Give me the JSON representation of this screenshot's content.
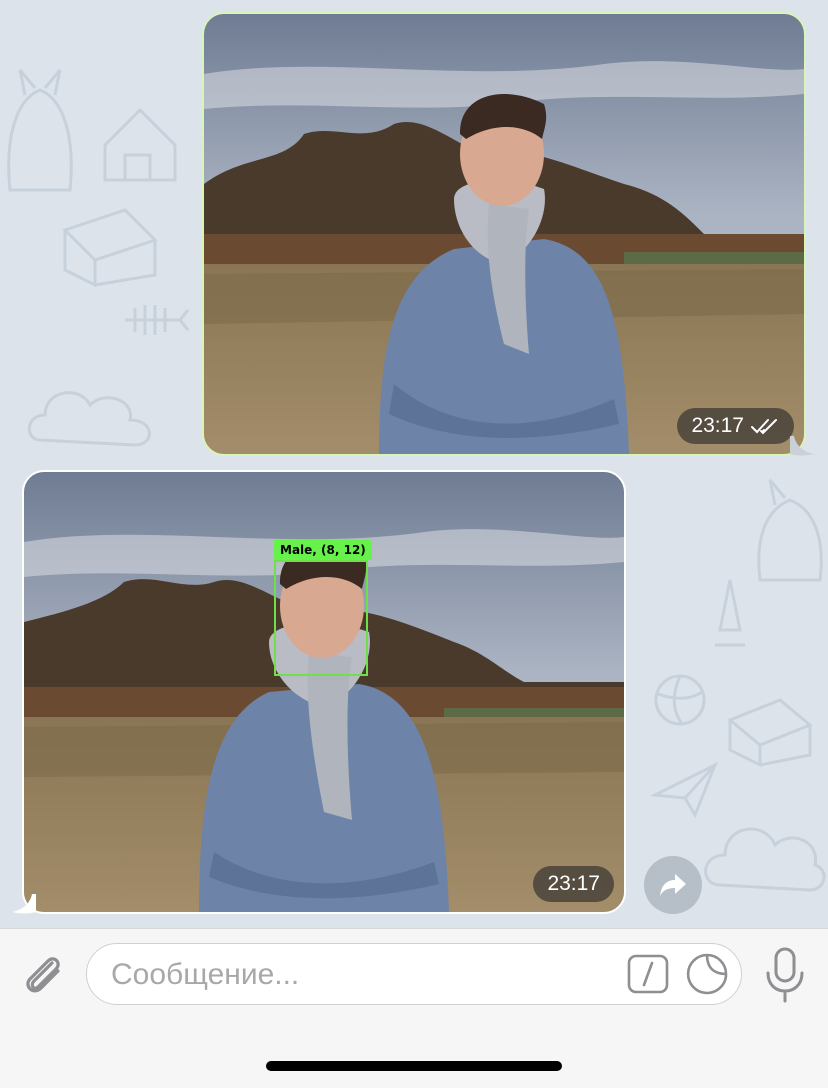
{
  "messages": [
    {
      "direction": "outgoing",
      "type": "photo",
      "time": "23:17",
      "status_icon": "double-check-icon"
    },
    {
      "direction": "incoming",
      "type": "photo",
      "time": "23:17",
      "detection": {
        "label": "Male, (8, 12)",
        "box_color": "#66f24a"
      }
    }
  ],
  "actions": {
    "share_icon": "share-arrow-icon"
  },
  "composer": {
    "placeholder": "Сообщение...",
    "value": "",
    "attach_icon": "paperclip-icon",
    "command_icon": "slash-command-icon",
    "sticker_icon": "sticker-icon",
    "mic_icon": "microphone-icon"
  },
  "colors": {
    "outgoing_border": "#d8f5b8",
    "detection_green": "#66f24a",
    "chat_background": "#dde3eb"
  }
}
